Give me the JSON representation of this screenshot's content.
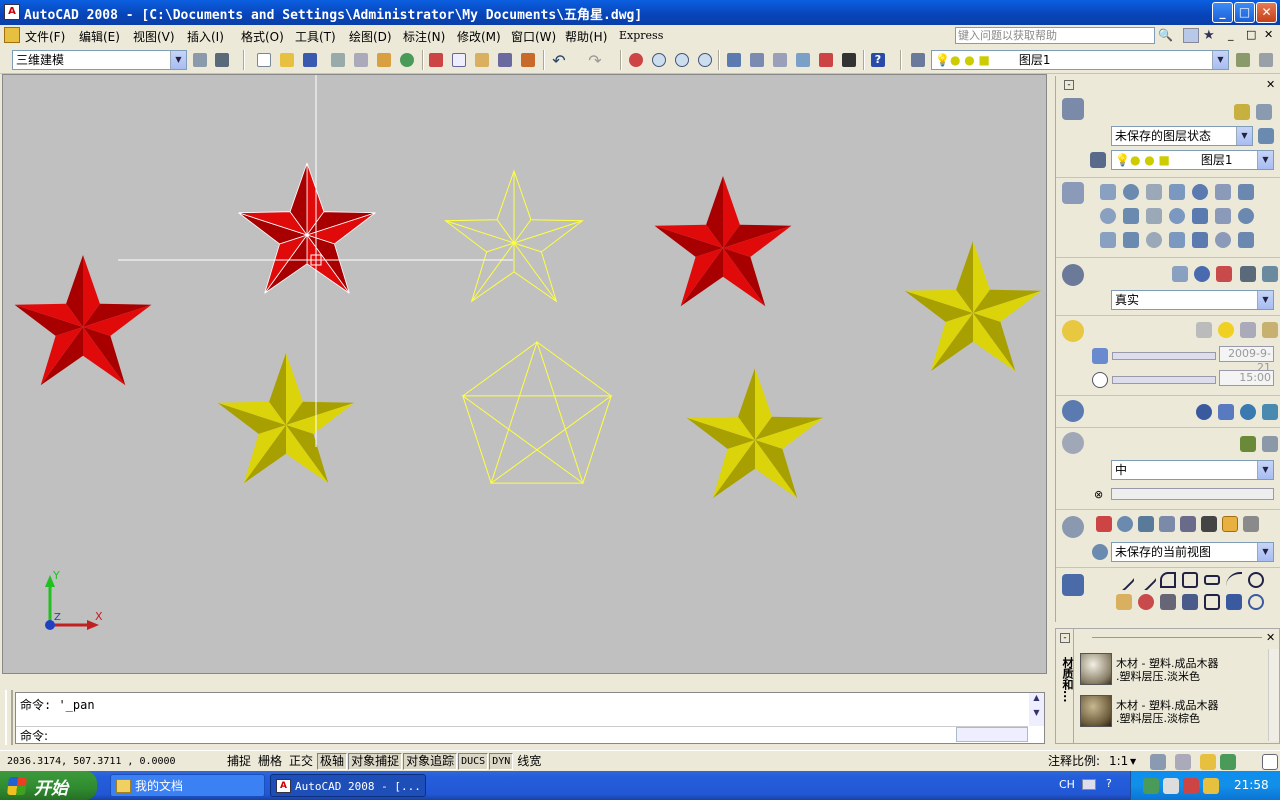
{
  "window": {
    "title": "AutoCAD 2008 - [C:\\Documents and Settings\\Administrator\\My Documents\\五角星.dwg]",
    "app_icon_label": "A",
    "minimize_label": "_",
    "maximize_label": "□",
    "close_label": "✕"
  },
  "menu": {
    "items": [
      "文件(F)",
      "编辑(E)",
      "视图(V)",
      "插入(I)",
      "格式(O)",
      "工具(T)",
      "绘图(D)",
      "标注(N)",
      "修改(M)",
      "窗口(W)",
      "帮助(H)",
      "Express"
    ],
    "help_placeholder": "键入问题以获取帮助",
    "doc_controls": [
      "_",
      "□",
      "✕"
    ]
  },
  "toolbar": {
    "workspace": "三维建模",
    "layer": "图层1"
  },
  "viewport": {
    "ucs_y": "Y",
    "ucs_x": "X",
    "ucs_z": "Z"
  },
  "panel": {
    "layer_state": "未保存的图层状态",
    "layer_current": "图层1",
    "visual_style": "真实",
    "date": "2009-9-21",
    "time": "15:00",
    "render_quality": "中",
    "view_state": "未保存的当前视图"
  },
  "materials": {
    "title": "材质和...",
    "items": [
      {
        "line1": "木材 - 塑料.成品木器",
        "line2": ".塑料层压.淡米色"
      },
      {
        "line1": "木材 - 塑料.成品木器",
        "line2": ".塑料层压.淡棕色"
      }
    ]
  },
  "command": {
    "history": "命令: '_pan",
    "prompt": "命令:"
  },
  "status": {
    "coords": "2036.3174,  507.3711  , 0.0000",
    "toggles": [
      {
        "label": "捕捉",
        "on": false
      },
      {
        "label": "栅格",
        "on": false
      },
      {
        "label": "正交",
        "on": false
      },
      {
        "label": "极轴",
        "on": true
      },
      {
        "label": "对象捕捉",
        "on": true
      },
      {
        "label": "对象追踪",
        "on": true
      },
      {
        "label": "DUCS",
        "on": true
      },
      {
        "label": "DYN",
        "on": true
      },
      {
        "label": "线宽",
        "on": false
      }
    ],
    "scale_label": "注释比例:",
    "scale_value": "1:1"
  },
  "taskbar": {
    "start": "开始",
    "tasks": [
      "我的文档",
      "AutoCAD 2008 - [..."
    ],
    "lang": "CH",
    "clock": "21:58"
  },
  "colors": {
    "red_star": "#d40000",
    "yellow_star": "#d4cc00",
    "wire": "#ffff40",
    "viewport_bg": "#c0c0c0"
  }
}
